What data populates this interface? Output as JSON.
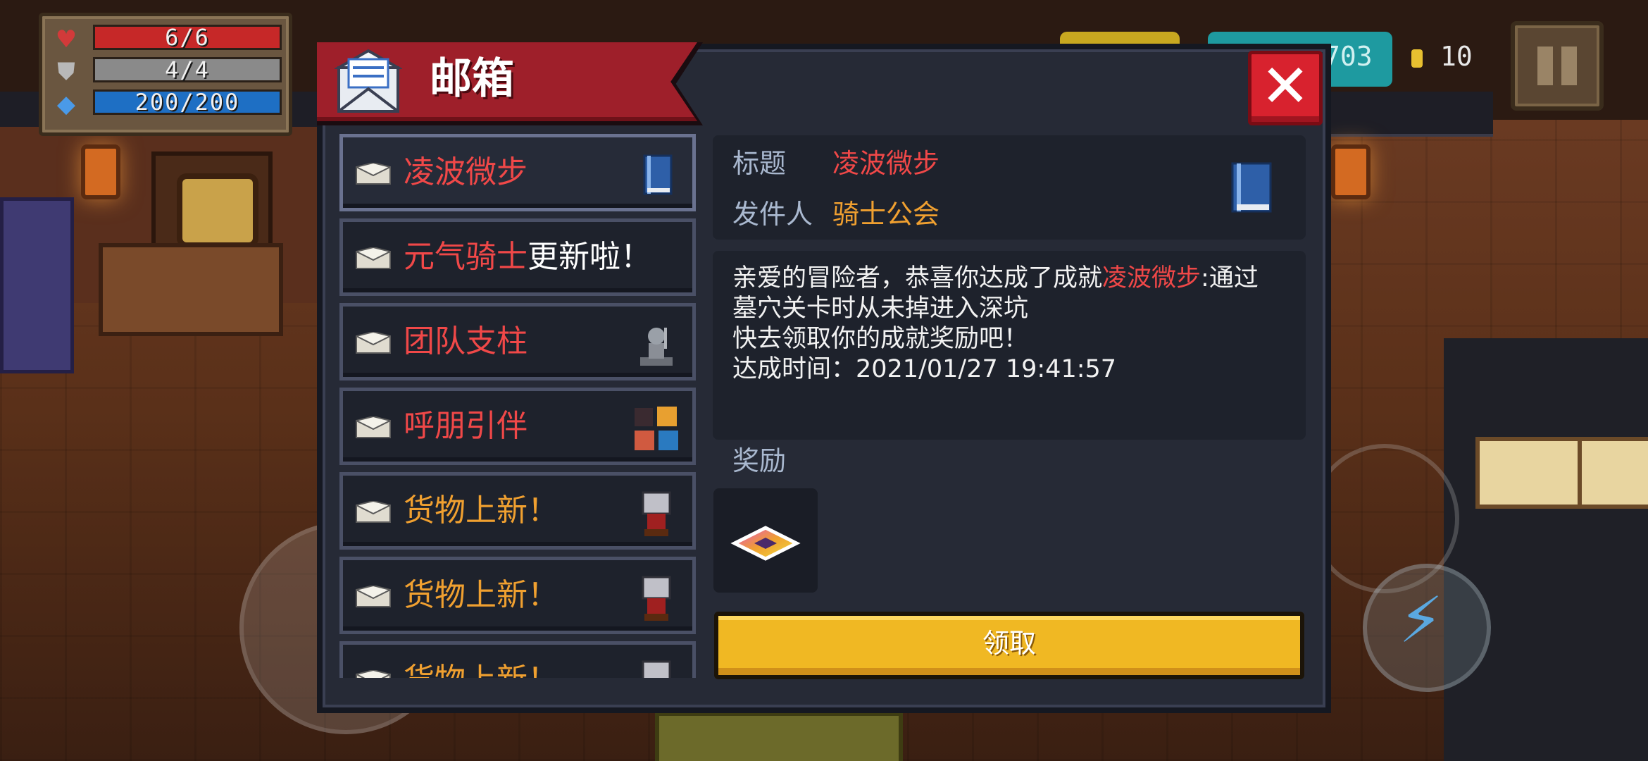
{
  "hud": {
    "hp": "6/6",
    "hp_fraction": 1.0,
    "armor": "4/4",
    "armor_fraction": 1.0,
    "energy": "200/200",
    "energy_fraction": 1.0,
    "gem_count": "703",
    "coin_count": "10",
    "icons": {
      "hp": "heart-icon",
      "armor": "shield-icon",
      "energy": "diamond-icon"
    },
    "colors": {
      "hp": "#c62828",
      "armor": "#8a8a8a",
      "energy": "#1e6fc4"
    }
  },
  "dialog": {
    "title": "邮箱",
    "close_label": "✕",
    "icons": {
      "mail": "mail-icon",
      "close": "close-icon"
    }
  },
  "mail_list": [
    {
      "parts": [
        {
          "text": "凌波微步",
          "color": "#f04848"
        }
      ],
      "thumb": "book-icon",
      "selected": true
    },
    {
      "parts": [
        {
          "text": "元气骑士",
          "color": "#f04848"
        },
        {
          "text": "更新啦！",
          "color": "#ffffff"
        }
      ],
      "thumb": "none",
      "selected": false
    },
    {
      "parts": [
        {
          "text": "团队支柱",
          "color": "#f04848"
        }
      ],
      "thumb": "knight-statue-icon",
      "selected": false
    },
    {
      "parts": [
        {
          "text": "呼朋引伴",
          "color": "#f04848"
        }
      ],
      "thumb": "party-icon",
      "selected": false
    },
    {
      "parts": [
        {
          "text": "货物上新！",
          "color": "#f0a030"
        }
      ],
      "thumb": "merchant-icon",
      "selected": false
    },
    {
      "parts": [
        {
          "text": "货物上新！",
          "color": "#f0a030"
        }
      ],
      "thumb": "merchant-icon",
      "selected": false
    },
    {
      "parts": [
        {
          "text": "货物上新！",
          "color": "#f0a030"
        }
      ],
      "thumb": "merchant-icon",
      "selected": false
    }
  ],
  "detail": {
    "title_label": "标题",
    "title_value": "凌波微步",
    "sender_label": "发件人",
    "sender_value": "骑士公会",
    "title_color": "#f04848",
    "sender_color": "#f0a030",
    "body_line1_pre": "亲爱的冒险者，恭喜你达成了成就",
    "body_line1_highlight": "凌波微步",
    "body_line1_post": ":通过",
    "body_line2": "墓穴关卡时从未掉进入深坑",
    "body_line3": "快去领取你的成就奖励吧！",
    "body_line4": "达成时间：2021/01/27 19:41:57",
    "reward_label": "奖励",
    "reward_icon": "gem-ticket-icon",
    "claim_label": "领取"
  }
}
